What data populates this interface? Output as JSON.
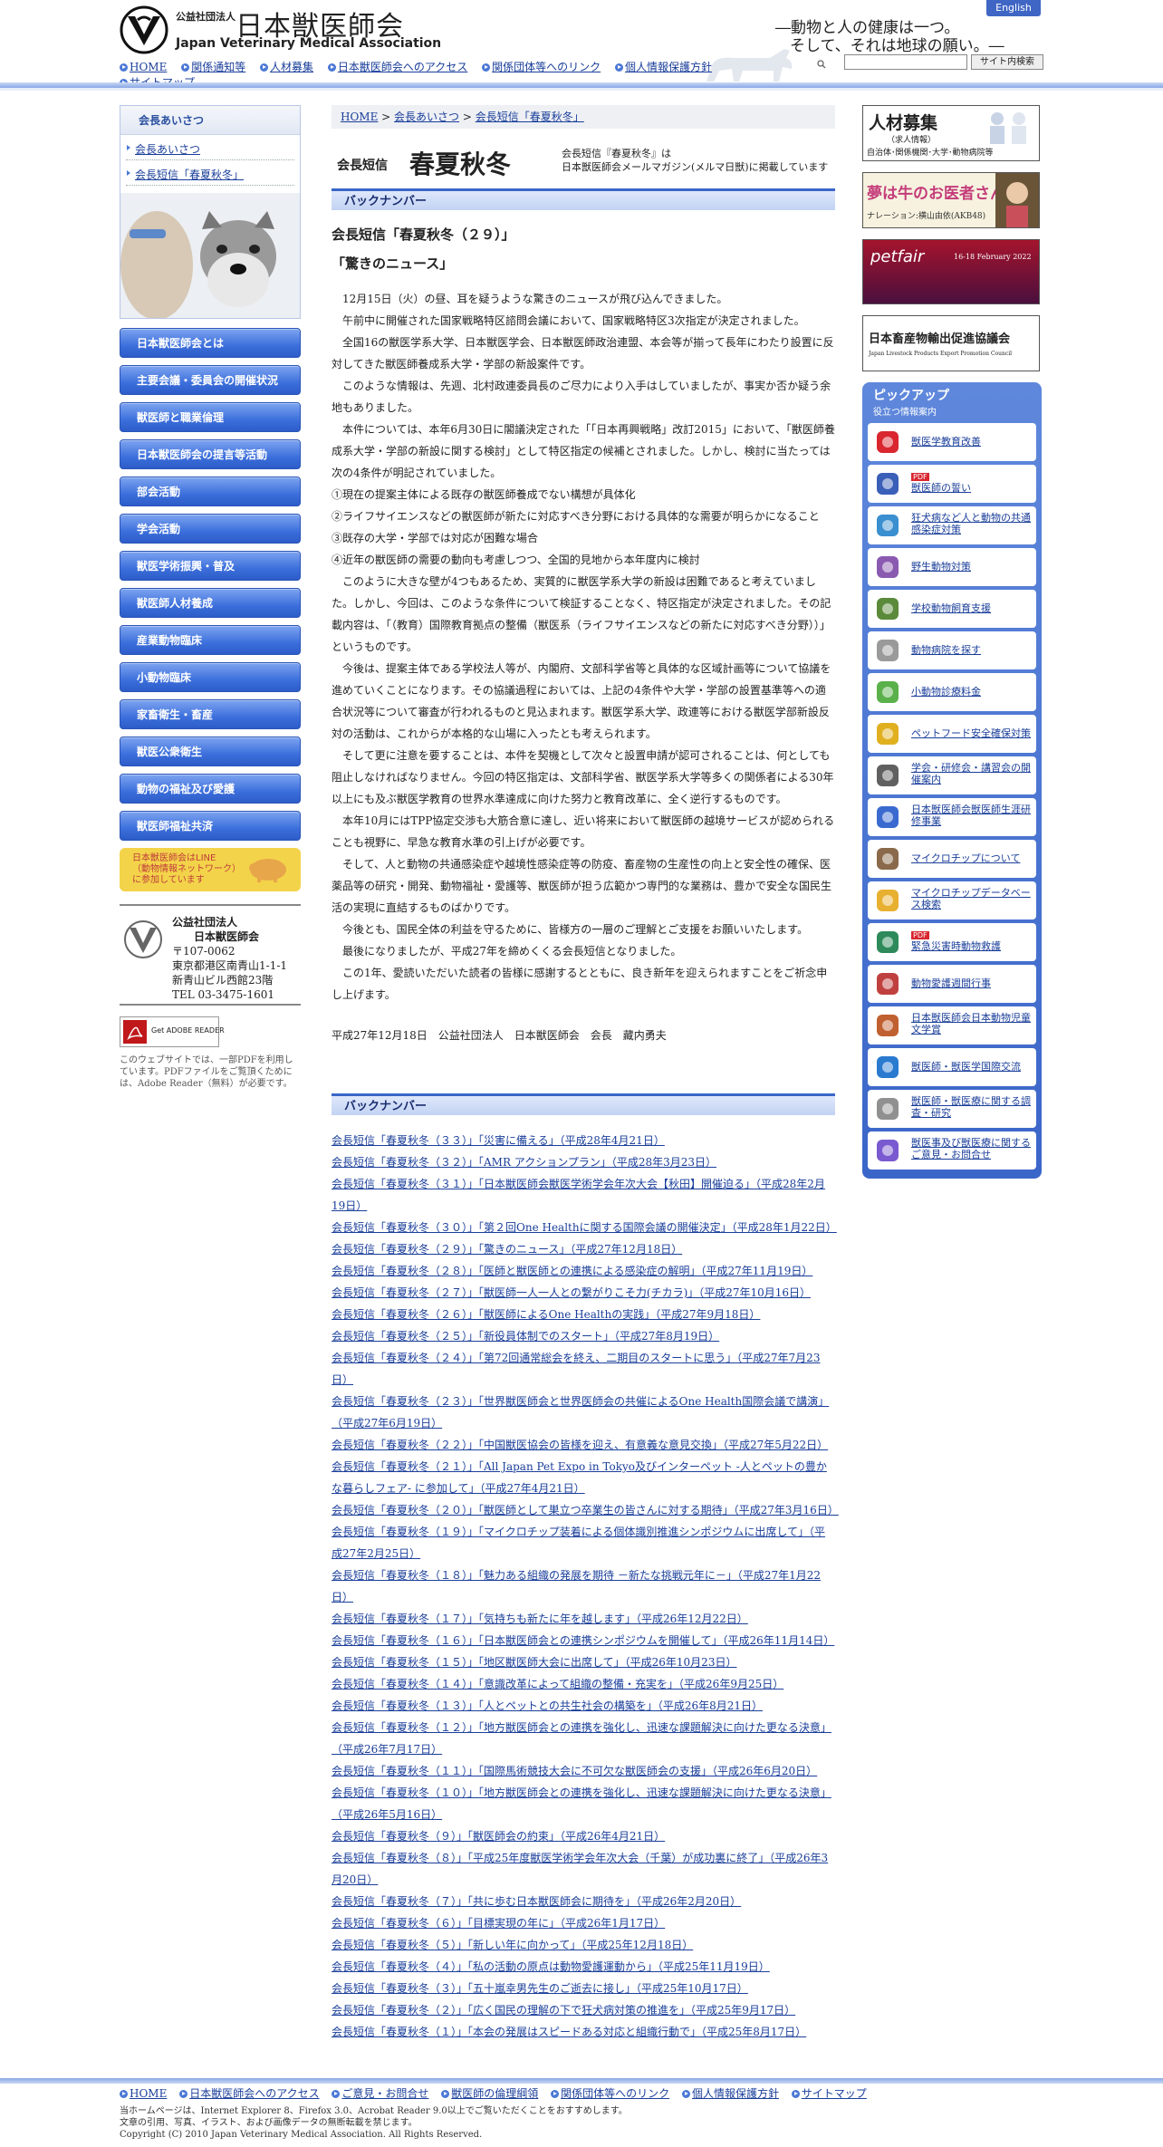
{
  "header": {
    "org_small": "公益社団法人",
    "org_name": "日本獣医師会",
    "org_en": "Japan Veterinary Medical Association",
    "english_label": "English",
    "slogan1": "―動物と人の健康は一つ。",
    "slogan2": "そして、それは地球の願い。―",
    "search_button": "サイト内検索",
    "nav": [
      "HOME",
      "関係通知等",
      "人材募集",
      "日本獣医師会へのアクセス",
      "関係団体等へのリンク",
      "個人情報保護方針",
      "サイトマップ"
    ]
  },
  "left": {
    "box_title": "会長あいさつ",
    "sub_items": [
      "会長あいさつ",
      "会長短信「春夏秋冬」"
    ],
    "nav": [
      "日本獣医師会とは",
      "主要会議・委員会の開催状況",
      "獣医師と職業倫理",
      "日本獣医師会の提言等活動",
      "部会活動",
      "学会活動",
      "獣医学術振興・普及",
      "獣医師人材養成",
      "産業動物臨床",
      "小動物臨床",
      "家畜衛生・畜産",
      "獣医公衆衛生",
      "動物の福祉及び愛護",
      "獣医師福祉共済"
    ],
    "line_banner": [
      "日本獣医師会はLINE",
      "（動物情報ネットワーク）",
      "に参加しています"
    ],
    "address": {
      "l1": "公益社団法人",
      "l2": "日本獣医師会",
      "l3": "〒107-0062",
      "l4": "東京都港区南青山1-1-1",
      "l5": "新青山ビル西館23階",
      "l6": "TEL 03-3475-1601"
    },
    "adobe_label": "Get ADOBE READER",
    "pdf_note": "このウェブサイトでは、一部PDFを利用しています。PDFファイルをご覧頂くためには、Adobe Reader（無料）が必要です。"
  },
  "main": {
    "breadcrumb": [
      "HOME",
      "会長あいさつ",
      "会長短信「春夏秋冬」"
    ],
    "title_small": "会長短信",
    "title_big": "春夏秋冬",
    "title_note1": "会長短信『春夏秋冬』は",
    "title_note2": "日本獣医師会メールマガジン(メルマ日獣)に掲載しています",
    "backnumber": "バックナンバー",
    "post_title": "会長短信「春夏秋冬（２９）」",
    "post_sub": "「驚きのニュース」",
    "paragraphs": [
      {
        "t": "12月15日（火）の昼、耳を疑うような驚きのニュースが飛び込んできました。",
        "i": true
      },
      {
        "t": "午前中に開催された国家戦略特区諮問会議において、国家戦略特区3次指定が決定されました。",
        "i": true
      },
      {
        "t": "全国16の獣医学系大学、日本獣医学会、日本獣医師政治連盟、本会等が揃って長年にわたり設置に反対してきた獣医師養成系大学・学部の新設案件です。",
        "i": true
      },
      {
        "t": "このような情報は、先週、北村政連委員長のご尽力により入手はしていましたが、事実か否か疑う余地もありました。",
        "i": true
      },
      {
        "t": "本件については、本年6月30日に閣議決定された「「日本再興戦略」改訂2015」において、「獣医師養成系大学・学部の新設に関する検討」として特区指定の候補とされました。しかし、検討に当たっては次の4条件が明記されていました。",
        "i": true
      },
      {
        "t": "①現在の提案主体による既存の獣医師養成でない構想が具体化",
        "i": false
      },
      {
        "t": "②ライフサイエンスなどの獣医師が新たに対応すべき分野における具体的な需要が明らかになること",
        "i": false
      },
      {
        "t": "③既存の大学・学部では対応が困難な場合",
        "i": false
      },
      {
        "t": "④近年の獣医師の需要の動向も考慮しつつ、全国的見地から本年度内に検討",
        "i": false
      },
      {
        "t": "このように大きな壁が4つもあるため、実質的に獣医学系大学の新設は困難であると考えていました。しかし、今回は、このような条件について検証することなく、特区指定が決定されました。その記載内容は、「（教育）国際教育拠点の整備（獣医系（ライフサイエンスなどの新たに対応すべき分野））」というものです。",
        "i": true
      },
      {
        "t": "今後は、提案主体である学校法人等が、内閣府、文部科学省等と具体的な区域計画等について協議を進めていくことになります。その協議過程においては、上記の4条件や大学・学部の設置基準等への適合状況等について審査が行われるものと見込まれます。獣医学系大学、政連等における獣医学部新設反対の活動は、これからが本格的な山場に入ったとも考えられます。",
        "i": true
      },
      {
        "t": "そして更に注意を要することは、本件を契機として次々と設置申請が認可されることは、何としても阻止しなければなりません。今回の特区指定は、文部科学省、獣医学系大学等多くの関係者による30年以上にも及ぶ獣医学教育の世界水準達成に向けた努力と教育改革に、全く逆行するものです。",
        "i": true
      },
      {
        "t": "本年10月にはTPP協定交渉も大筋合意に達し、近い将来において獣医師の越境サービスが認められることも視野に、早急な教育水準の引上げが必要です。",
        "i": true
      },
      {
        "t": "そして、人と動物の共通感染症や越境性感染症等の防疫、畜産物の生産性の向上と安全性の確保、医薬品等の研究・開発、動物福祉・愛護等、獣医師が担う広範かつ専門的な業務は、豊かで安全な国民生活の実現に直結するものばかりです。",
        "i": true
      },
      {
        "t": "今後とも、国民全体の利益を守るために、皆様方の一層のご理解とご支援をお願いいたします。",
        "i": true
      },
      {
        "t": "最後になりましたが、平成27年を締めくくる会長短信となりました。",
        "i": true
      },
      {
        "t": "この1年、愛読いただいた読者の皆様に感謝するとともに、良き新年を迎えられますことをご祈念申し上げます。",
        "i": true
      }
    ],
    "signature": "平成27年12月18日　公益社団法人　日本獣医師会　会長　藏内勇夫",
    "backnumbers": [
      "会長短信「春夏秋冬（３３）」「災害に備える」（平成28年4月21日）",
      "会長短信「春夏秋冬（３２）」「AMR アクションプラン」（平成28年3月23日）",
      "会長短信「春夏秋冬（３１）」「日本獣医師会獣医学術学会年次大会【秋田】開催迫る」（平成28年2月19日）",
      "会長短信「春夏秋冬（３０）」「第２回One Healthに関する国際会議の開催決定」（平成28年1月22日）",
      "会長短信「春夏秋冬（２９）」「驚きのニュース」（平成27年12月18日）",
      "会長短信「春夏秋冬（２８）」「医師と獣医師との連携による感染症の解明」（平成27年11月19日）",
      "会長短信「春夏秋冬（２７）」「獣医師一人一人との繋がりこそ力(チカラ)」（平成27年10月16日）",
      "会長短信「春夏秋冬（２６）」「獣医師によるOne Healthの実践」（平成27年9月18日）",
      "会長短信「春夏秋冬（２５）」「新役員体制でのスタート」（平成27年8月19日）",
      "会長短信「春夏秋冬（２４）」「第72回通常総会を終え、二期目のスタートに思う」（平成27年7月23日）",
      "会長短信「春夏秋冬（２３）」「世界獣医師会と世界医師会の共催によるOne Health国際会議で講演」（平成27年6月19日）",
      "会長短信「春夏秋冬（２２）」「中国獣医協会の皆様を迎え、有意義な意見交換」（平成27年5月22日）",
      "会長短信「春夏秋冬（２１）」「All Japan Pet Expo in Tokyo及びインターペット -人とペットの豊かな暮らしフェア- に参加して」（平成27年4月21日）",
      "会長短信「春夏秋冬（２０）」「獣医師として巣立つ卒業生の皆さんに対する期待」（平成27年3月16日）",
      "会長短信「春夏秋冬（１９）」「マイクロチップ装着による個体識別推進シンポジウムに出席して」（平成27年2月25日）",
      "会長短信「春夏秋冬（１８）」「魅力ある組織の発展を期待 －新たな挑戦元年に－」（平成27年1月22日）",
      "会長短信「春夏秋冬（１７）」「気持ちも新たに年を越します」（平成26年12月22日）",
      "会長短信「春夏秋冬（１６）」「日本獣医師会との連携シンポジウムを開催して」（平成26年11月14日）",
      "会長短信「春夏秋冬（１５）」「地区獣医師大会に出席して」（平成26年10月23日）",
      "会長短信「春夏秋冬（１４）」「意識改革によって組織の整備・充実を」（平成26年9月25日）",
      "会長短信「春夏秋冬（１３）」「人とペットとの共生社会の構築を」（平成26年8月21日）",
      "会長短信「春夏秋冬（１２）」「地方獣医師会との連携を強化し、迅速な課題解決に向けた更なる決意」（平成26年7月17日）",
      "会長短信「春夏秋冬（１１）」「国際馬術競技大会に不可欠な獣医師会の支援」（平成26年6月20日）",
      "会長短信「春夏秋冬（１０）」「地方獣医師会との連携を強化し、迅速な課題解決に向けた更なる決意」（平成26年5月16日）",
      "会長短信「春夏秋冬（９）」「獣医師会の約束」（平成26年4月21日）",
      "会長短信「春夏秋冬（８）」「平成25年度獣医学術学会年次大会（千葉）が成功裏に終了」（平成26年3月20日）",
      "会長短信「春夏秋冬（７）」「共に歩む日本獣医師会に期待を」（平成26年2月20日）",
      "会長短信「春夏秋冬（６）」「目標実現の年に」（平成26年1月17日）",
      "会長短信「春夏秋冬（５）」「新しい年に向かって」（平成25年12月18日）",
      "会長短信「春夏秋冬（４）」「私の活動の原点は動物愛護運動から」（平成25年11月19日）",
      "会長短信「春夏秋冬（３）」「五十嵐幸男先生のご逝去に接し」（平成25年10月17日）",
      "会長短信「春夏秋冬（２）」「広く国民の理解の下で狂犬病対策の推進を」（平成25年9月17日）",
      "会長短信「春夏秋冬（１）」「本会の発展はスピードある対応と組織行動で」（平成25年8月17日）"
    ]
  },
  "right": {
    "recruit_title": "人材募集",
    "recruit_sub": "（求人情報）",
    "recruit_note": "自治体･関係機関･大学･動物病院等",
    "ushi_label": "夢は牛のお医者さん",
    "ushi_sub": "ナレーション:横山由依(AKB48)",
    "petfair_label": "petfair",
    "petfair_date": "16-18 February 2022",
    "export_label": "日本畜産物輸出促進協議会",
    "export_sub": "Japan Livestock Products Export Promotion Council",
    "pickup_title": "ピックアップ",
    "pickup_sub": "役立つ情報案内",
    "pickups": [
      {
        "icon": "heart-icon",
        "label": "獣医学教育改善"
      },
      {
        "icon": "pdf-doc-icon",
        "label": "獣医師の誓い",
        "badge": "PDF"
      },
      {
        "icon": "test-tube-icon",
        "label": "狂犬病など人と動物の共通感染症対策"
      },
      {
        "icon": "collar-icon",
        "label": "野生動物対策"
      },
      {
        "icon": "duck-icon",
        "label": "学校動物飼育支援"
      },
      {
        "icon": "cat-dog-icon",
        "label": "動物病院を探す"
      },
      {
        "icon": "bird-icon",
        "label": "小動物診療料金"
      },
      {
        "icon": "pet-food-icon",
        "label": "ペットフード安全確保対策"
      },
      {
        "icon": "calendar-icon",
        "label": "学会・研修会・講習会の開催案内"
      },
      {
        "icon": "monitor-icon",
        "label": "日本獣医師会獣医師生涯研修事業"
      },
      {
        "icon": "dog-tag-icon",
        "label": "マイクロチップについて"
      },
      {
        "icon": "chip-icon",
        "label": "マイクロチップデータベース検索"
      },
      {
        "icon": "first-aid-icon",
        "label": "緊急災害時動物救護",
        "badge": "PDF"
      },
      {
        "icon": "week-calendar-icon",
        "label": "動物愛護週間行事"
      },
      {
        "icon": "pencil-icon",
        "label": "日本獣医師会日本動物児童文学賞"
      },
      {
        "icon": "globe-icon",
        "label": "獣医師・獣医学国際交流"
      },
      {
        "icon": "id-card-icon",
        "label": "獣医師・獣医療に関する調査・研究"
      },
      {
        "icon": "speech-icon",
        "label": "獣医事及び獣医療に関するご意見・お問合せ"
      }
    ]
  },
  "footer": {
    "nav": [
      "HOME",
      "日本獣医師会へのアクセス",
      "ご意見・お問合せ",
      "獣医師の倫理綱領",
      "関係団体等へのリンク",
      "個人情報保護方針",
      "サイトマップ"
    ],
    "note1": "当ホームページは、Internet Explorer 8、Firefox 3.0、Acrobat Reader 9.0以上でご覧いただくことをおすすめします。",
    "note2": "文章の引用、写真、イラスト、および画像データの無断転載を禁じます。",
    "copyright": "Copyright (C) 2010 Japan Veterinary Medical Association. All Rights Reserved."
  }
}
